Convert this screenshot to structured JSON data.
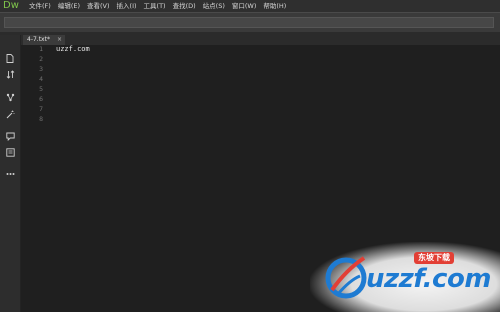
{
  "app": {
    "logo": "Dw"
  },
  "menu": [
    "文件(F)",
    "编辑(E)",
    "查看(V)",
    "插入(I)",
    "工具(T)",
    "查找(D)",
    "站点(S)",
    "窗口(W)",
    "帮助(H)"
  ],
  "tab": {
    "title": "4-7.txt*",
    "close": "×"
  },
  "editor": {
    "line_numbers": [
      "1",
      "2",
      "3",
      "4",
      "5",
      "6",
      "7",
      "8"
    ],
    "lines": [
      "uzzf.com",
      "",
      "",
      "",
      "",
      "",
      "",
      ""
    ]
  },
  "left_panel_icons": [
    "file-icon",
    "sort-icon",
    "branch-icon",
    "wand-icon",
    "comment-icon",
    "snippet-icon",
    "more-icon"
  ],
  "watermark": {
    "text": "uzzf.com",
    "badge": "东坡下载"
  },
  "colors": {
    "logo": "#7ec34b",
    "background": "#1e1e1e",
    "menubar": "#2f2f2f",
    "watermark_blue": "#1e7bd2",
    "watermark_red": "#e23f35"
  }
}
